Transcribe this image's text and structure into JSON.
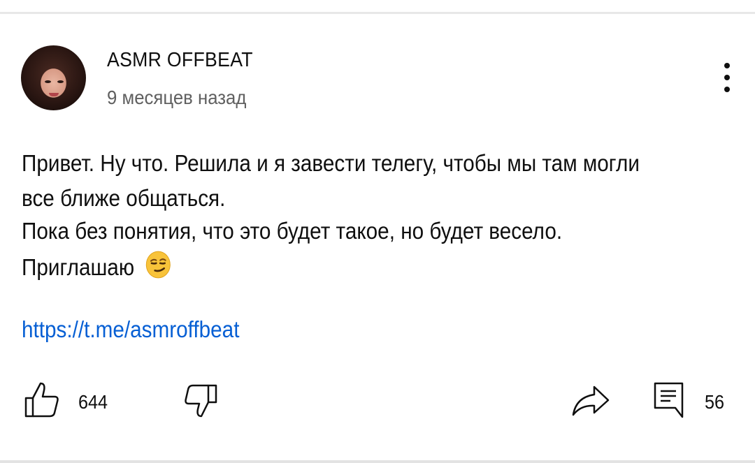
{
  "comment": {
    "author": "ASMR OFFBEAT",
    "time": "9 месяцев назад",
    "lines": [
      "Привет. Ну что. Решила и я завести телегу, чтобы мы там могли",
      "все ближе общаться.",
      "Пока без понятия, что это будет такое, но будет весело.",
      "Приглашаю"
    ],
    "emoji": "smirking-face",
    "link": "https://t.me/asmroffbeat"
  },
  "actions": {
    "likes": "644",
    "replies": "56"
  },
  "icons": [
    "more-vert-icon",
    "like-icon",
    "dislike-icon",
    "share-icon",
    "reply-icon"
  ],
  "colors": {
    "link": "#065fd4",
    "secondary_text": "#606060"
  }
}
